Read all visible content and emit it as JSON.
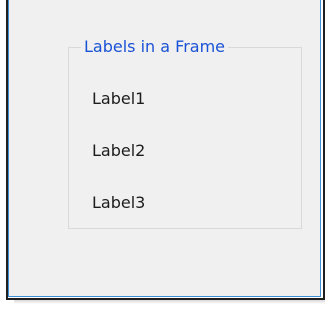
{
  "frame": {
    "title": "Labels in a Frame",
    "labels": [
      "Label1",
      "Label2",
      "Label3"
    ]
  },
  "colors": {
    "frame_title": "#1a52d6",
    "window_background": "#f0f0f0",
    "window_accent_border": "#3c8ed6",
    "groupbox_border": "#d9d9d9"
  }
}
